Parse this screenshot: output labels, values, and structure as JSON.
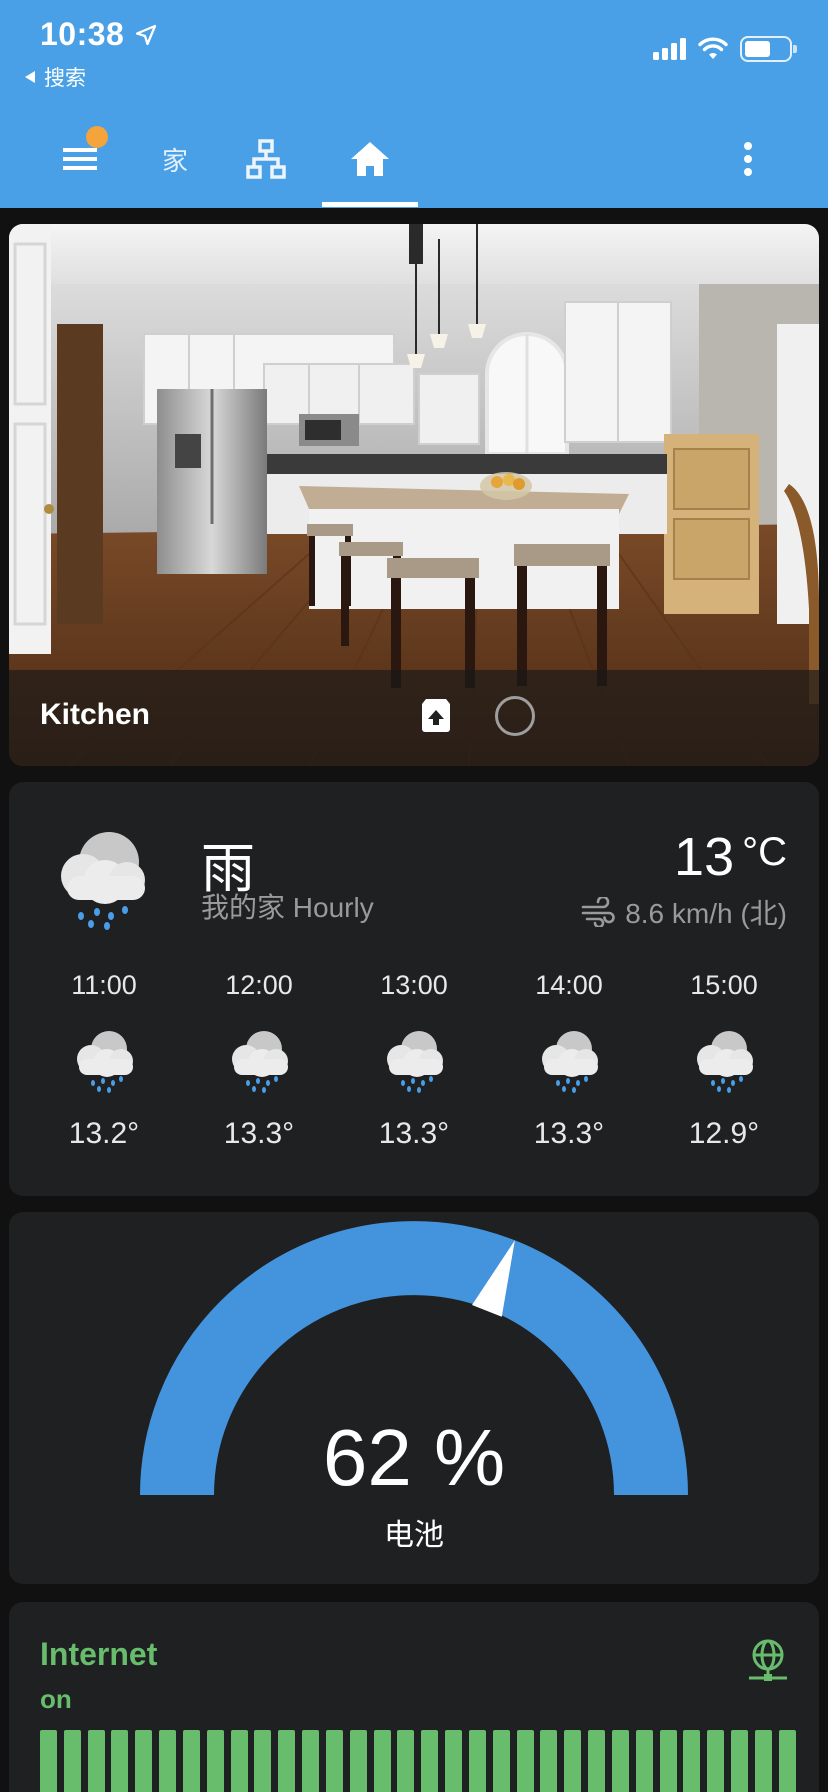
{
  "status_bar": {
    "time": "10:38",
    "back_label": "搜索"
  },
  "toolbar": {
    "home_tab_label": "家",
    "badge_color": "#f4a43a",
    "icons": [
      "menu-icon",
      "network-icon",
      "house-icon",
      "more-vert-icon"
    ]
  },
  "kitchen": {
    "title": "Kitchen"
  },
  "weather": {
    "condition": "雨",
    "subtitle": "我的家 Hourly",
    "temperature": "13",
    "temp_unit": "°C",
    "wind": "8.6 km/h (北)",
    "forecast": [
      {
        "time": "11:00",
        "temp": "13.2°"
      },
      {
        "time": "12:00",
        "temp": "13.3°"
      },
      {
        "time": "13:00",
        "temp": "13.3°"
      },
      {
        "time": "14:00",
        "temp": "13.3°"
      },
      {
        "time": "15:00",
        "temp": "12.9°"
      }
    ]
  },
  "gauge": {
    "value": 62,
    "value_text": "62 %",
    "label": "电池",
    "color": "#4493dd"
  },
  "internet": {
    "title": "Internet",
    "state": "on",
    "color": "#67bd6b"
  }
}
